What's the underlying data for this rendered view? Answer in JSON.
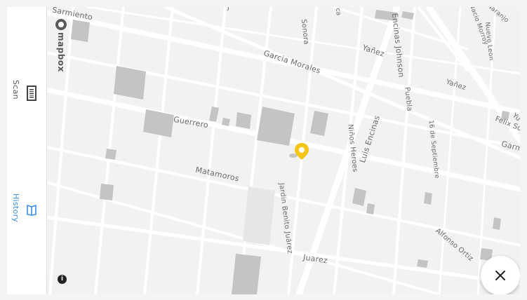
{
  "sidebar": {
    "items": [
      {
        "label": "Scan",
        "icon": "barcode-icon",
        "active": false
      },
      {
        "label": "History",
        "icon": "book-icon",
        "active": true
      }
    ]
  },
  "map": {
    "attribution": "mapbox",
    "info_glyph": "i",
    "streets": {
      "sarmiento": "Sarmiento",
      "garcia_morales": "Garcia Morales",
      "guerrero": "Guerrero",
      "matamoros": "Matamoros",
      "juarez": "Juarez",
      "jardin_benito_juarez": "Jardin Benito Juárez",
      "ninos_heroes": "Niños Heroes",
      "luis_encinas": "Luis Encinas",
      "encinas_johnson": "Encinas Johnson",
      "sonora": "Sonora",
      "yanez_1": "Yañez",
      "yanez_2": "Yañez",
      "puebla": "Puebla",
      "16_de_septiembre": "16 de Septiembre",
      "felix_soria": "Felix Soria",
      "garmendia": "Garmen",
      "alfonso_ortiz": "Alfonso Ortiz",
      "nuevo_leon": "Nuevo Leon",
      "ignacio_morroy": "Nacio Morroy",
      "naranjo": "Naranjo",
      "yucatan": "Yu",
      "ca": "ca",
      "j": "J"
    },
    "pin_color": "#f5c518"
  },
  "close_button": {
    "icon": "close-icon"
  },
  "colors": {
    "accent": "#3a8ee6",
    "road": "#ffffff",
    "building": "#c4c4c4",
    "background": "#f2f2f2"
  }
}
